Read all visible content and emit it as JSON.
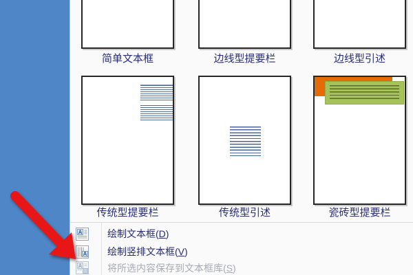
{
  "window": {
    "app": "Word 文本框下拉库 (Text Box gallery dropdown)"
  },
  "gallery": {
    "items": [
      {
        "label": "简单文本框"
      },
      {
        "label": "边线型提要栏"
      },
      {
        "label": "边线型引述"
      },
      {
        "label": "传统型提要栏"
      },
      {
        "label": "传统型引述"
      },
      {
        "label": "瓷砖型提要栏"
      }
    ]
  },
  "menu": {
    "items": [
      {
        "pre": "绘制文本框(",
        "key": "D",
        "post": ")",
        "enabled": true
      },
      {
        "pre": "绘制竖排文本框(",
        "key": "V",
        "post": ")",
        "enabled": true
      },
      {
        "pre": "将所选内容保存到文本框库(",
        "key": "S",
        "post": ")",
        "enabled": false
      }
    ]
  },
  "colors": {
    "document_blue": "#4e86c7",
    "panel_bg": "#fafafa",
    "thumb_border": "#262626",
    "label_navy": "#272e7a",
    "menu_text_navy": "#262c6e",
    "disabled_gray": "#a7abb3",
    "tile_orange": "#e36c09",
    "tile_green": "#a5c25c",
    "arrow_red": "#e81717"
  }
}
